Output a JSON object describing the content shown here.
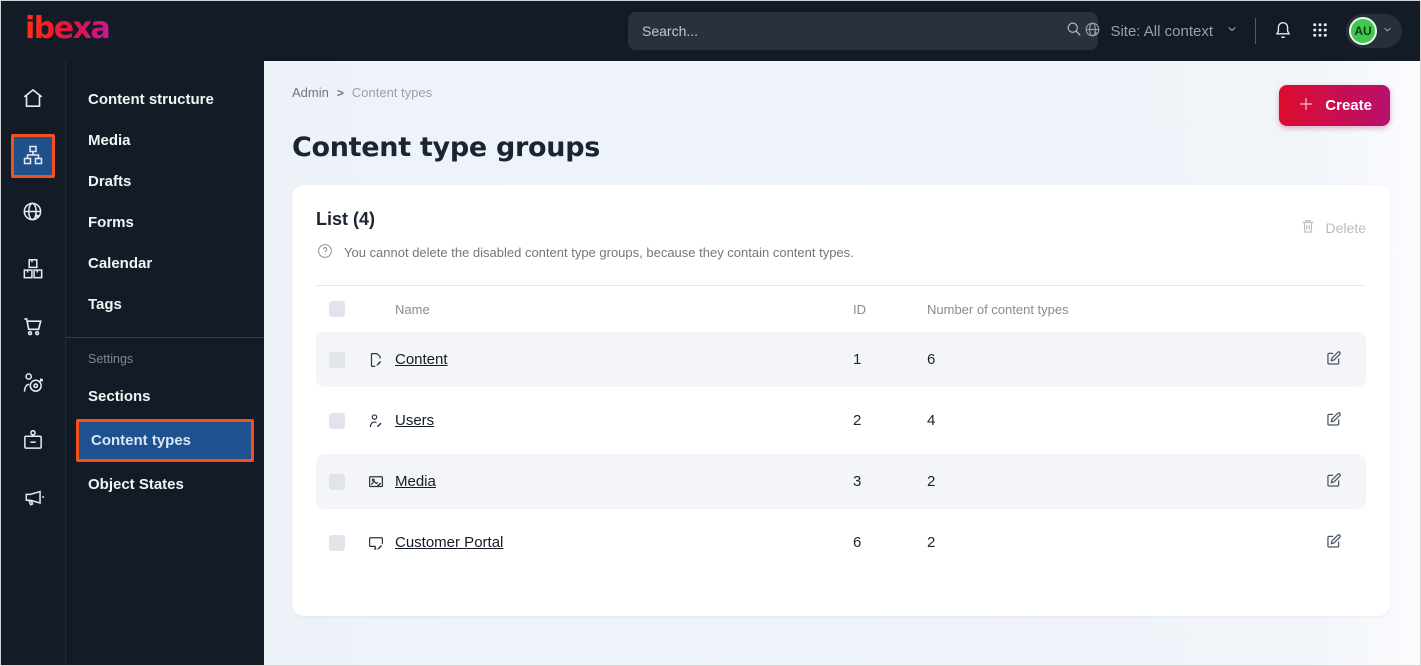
{
  "topbar": {
    "logo": "ibexa",
    "search_placeholder": "Search...",
    "site_label": "Site: All context",
    "avatar_initials": "AU",
    "icons": [
      "search-icon",
      "site-globe-icon",
      "chevron-down-icon",
      "bell-icon",
      "app-grid-icon"
    ]
  },
  "rail": {
    "active_index": 1,
    "icons": [
      "home-icon",
      "sitemap-icon",
      "web-globe-icon",
      "packages-icon",
      "cart-icon",
      "personalization-icon",
      "badge-icon",
      "megaphone-icon"
    ]
  },
  "sidebar": {
    "items": [
      {
        "label": "Content structure"
      },
      {
        "label": "Media"
      },
      {
        "label": "Drafts"
      },
      {
        "label": "Forms"
      },
      {
        "label": "Calendar"
      },
      {
        "label": "Tags"
      }
    ],
    "section_label": "Settings",
    "settings_items": [
      {
        "label": "Sections",
        "active": false
      },
      {
        "label": "Content types",
        "active": true
      },
      {
        "label": "Object States",
        "active": false
      }
    ]
  },
  "breadcrumb": {
    "root": "Admin",
    "separator": ">",
    "current": "Content types"
  },
  "page": {
    "title": "Content type groups"
  },
  "actions": {
    "create_label": "Create",
    "delete_label": "Delete"
  },
  "list": {
    "title": "List (4)",
    "help_text": "You cannot delete the disabled content type groups, because they contain content types."
  },
  "table": {
    "headers": {
      "name": "Name",
      "id": "ID",
      "count": "Number of content types"
    },
    "rows": [
      {
        "icon": "content-file-icon",
        "name": "Content",
        "id": "1",
        "count": "6"
      },
      {
        "icon": "user-icon",
        "name": "Users",
        "id": "2",
        "count": "4"
      },
      {
        "icon": "image-icon",
        "name": "Media",
        "id": "3",
        "count": "2"
      },
      {
        "icon": "monitor-icon",
        "name": "Customer Portal",
        "id": "6",
        "count": "2"
      }
    ]
  },
  "colors": {
    "topbar_bg": "#131c26",
    "highlight_orange": "#f4501e",
    "selected_blue": "#1f5191",
    "create_gradient_start": "#dc0c2d",
    "create_gradient_end": "#b8106e",
    "avatar_green": "#41c74d",
    "main_bg": "#eff3f9"
  }
}
